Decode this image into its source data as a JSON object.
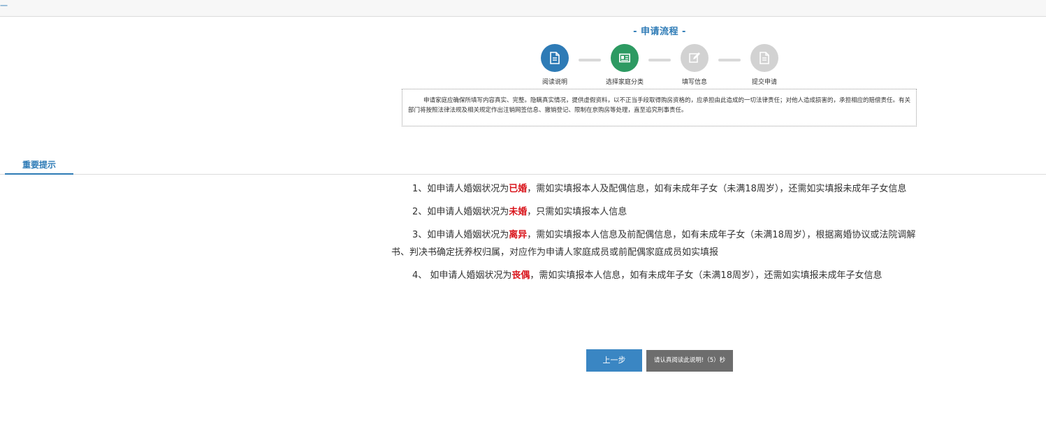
{
  "topbar": {
    "mark": "一"
  },
  "flow": {
    "title": "- 申请流程 -",
    "steps": [
      {
        "label": "阅读说明",
        "icon": "document-icon",
        "color": "#2e7bb6"
      },
      {
        "label": "选择家庭分类",
        "icon": "id-card-icon",
        "color": "#2d9a62"
      },
      {
        "label": "填写信息",
        "icon": "edit-icon",
        "color": "#d2d2d2"
      },
      {
        "label": "提交申请",
        "icon": "document-icon",
        "color": "#d2d2d2"
      }
    ]
  },
  "notice": "申请家庭应确保所填写内容真实、完整。隐瞒真实情况，提供虚假资料，以不正当手段取得购房资格的，应承担由此造成的一切法律责任；对他人造成损害的，承担相应的赔偿责任。有关部门将按照法律法规及相关规定作出注销网签信息、撤销登记、限制在京购房等处理，直至追究刑事责任。",
  "tab": {
    "label": "重要提示"
  },
  "tips": [
    {
      "before": "1、如申请人婚姻状况为",
      "highlight": "已婚",
      "after": "，需如实填报本人及配偶信息，如有未成年子女（未满18周岁），还需如实填报未成年子女信息"
    },
    {
      "before": "2、如申请人婚姻状况为",
      "highlight": "未婚",
      "after": "，只需如实填报本人信息"
    },
    {
      "before": "3、如申请人婚姻状况为",
      "highlight": "离异",
      "after": "，需如实填报本人信息及前配偶信息，如有未成年子女（未满18周岁），根据离婚协议或法院调解书、判决书确定抚养权归属，对应作为申请人家庭成员或前配偶家庭成员如实填报"
    },
    {
      "before": "4、 如申请人婚姻状况为",
      "highlight": "丧偶",
      "after": "，需如实填报本人信息，如有未成年子女（未满18周岁），还需如实填报未成年子女信息"
    }
  ],
  "buttons": {
    "prev": "上一步",
    "wait": "请认真阅读此说明!（5）秒"
  },
  "colors": {
    "accent": "#2e7bb6",
    "step_done_green": "#2d9a62",
    "step_pending": "#d2d2d2",
    "highlight_red": "#d9141b",
    "button_disabled": "#6d6d6d"
  }
}
